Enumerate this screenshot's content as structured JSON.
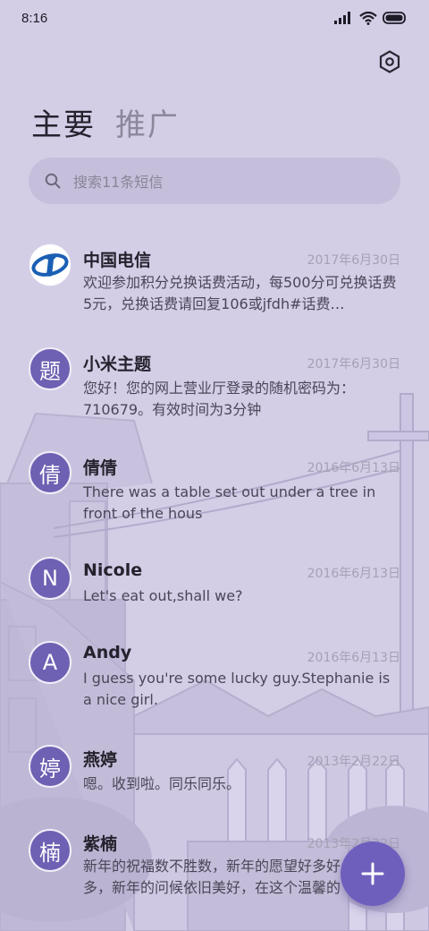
{
  "status_bar": {
    "time": "8:16"
  },
  "tabs": [
    {
      "label": "主要",
      "active": true
    },
    {
      "label": "推广",
      "active": false
    }
  ],
  "search": {
    "placeholder": "搜索11条短信"
  },
  "conversations": [
    {
      "avatar_letter": "",
      "avatar_type": "china-telecom-logo",
      "name": "中国电信",
      "date": "2017年6月30日",
      "preview": "欢迎参加积分兑换话费活动，每500分可兑换话费5元，兑换话费请回复106或jfdh#话费…"
    },
    {
      "avatar_letter": "题",
      "name": "小米主题",
      "date": "2017年6月30日",
      "preview": "您好！您的网上营业厅登录的随机密码为：710679。有效时间为3分钟"
    },
    {
      "avatar_letter": "倩",
      "name": "倩倩",
      "date": "2016年6月13日",
      "preview": "There was a table set out under a tree in front of the hous"
    },
    {
      "avatar_letter": "N",
      "name": "Nicole",
      "date": "2016年6月13日",
      "preview": "Let's eat out,shall we?"
    },
    {
      "avatar_letter": "A",
      "name": "Andy",
      "date": "2016年6月13日",
      "preview": "I guess you're some lucky guy.Stephanie is a nice girl."
    },
    {
      "avatar_letter": "婷",
      "name": "燕婷",
      "date": "2013年2月22日",
      "preview": "嗯。收到啦。同乐同乐。"
    },
    {
      "avatar_letter": "楠",
      "name": "紫楠",
      "date": "2013年2月22日",
      "preview": "新年的祝福数不胜数，新年的愿望好多好多，新年的问候依旧美好，在这个温馨的时刻"
    }
  ],
  "colors": {
    "accent": "#6f5fbd",
    "background": "#d3cde6"
  }
}
